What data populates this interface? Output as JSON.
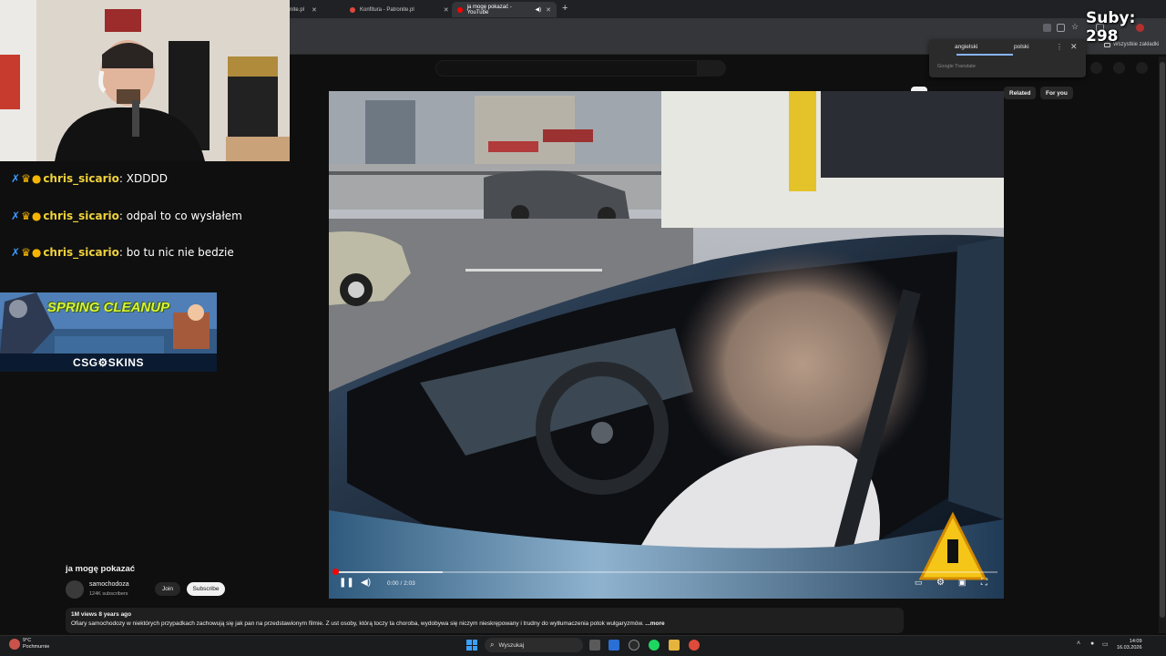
{
  "browser": {
    "tabs": [
      {
        "label": "nite.pl"
      },
      {
        "label": "Konfitura - Patronite.pl"
      },
      {
        "label": "ja mogę pokazać - YouTube"
      }
    ],
    "new_tab": "+",
    "bookmarks_all": "Wszystkie zakładki"
  },
  "translate": {
    "lang_from": "angielski",
    "lang_to": "polski",
    "brand": "Google Translate",
    "menu_icon": "⋮",
    "close_icon": "✕"
  },
  "youtube": {
    "chips": [
      "Related",
      "For you"
    ],
    "video": {
      "title": "ja mogę pokazać",
      "time": "0:00 / 2:03",
      "progress": 0
    },
    "channel": {
      "name": "samochodoza",
      "subscribers": "124K subscribers",
      "join_label": "Join",
      "subscribe_label": "Subscribe"
    },
    "description": {
      "meta": "1M views  8 years ago",
      "text": "Ofiary samochodozy w niektórych przypadkach zachowują się jak pan na przedstawionym filmie. Z ust osoby, którą toczy ta choroba, wydobywa się niczym nieskrępowany i trudny do wytłumaczenia potok wulgaryzmów.",
      "more": " ...more"
    }
  },
  "stream": {
    "subs_counter": "Suby: 298",
    "chat": [
      {
        "user": "chris_sicario",
        "message": "XDDDD"
      },
      {
        "user": "chris_sicario",
        "message": "odpal to co wysłałem"
      },
      {
        "user": "chris_sicario",
        "message": "bo tu nic nie bedzie"
      }
    ],
    "ad": {
      "title": "SPRING CLEANUP",
      "brand": "CSG⚙SKINS"
    }
  },
  "taskbar": {
    "weather_temp": "9°C",
    "weather_desc": "Pochmurnie",
    "search_placeholder": "Wyszukaj",
    "time": "14:09",
    "date": "16.03.2026"
  },
  "colors": {
    "accent_red": "#ff0000",
    "chat_username": "#f0d23c",
    "translate_accent": "#8ab4f8"
  }
}
